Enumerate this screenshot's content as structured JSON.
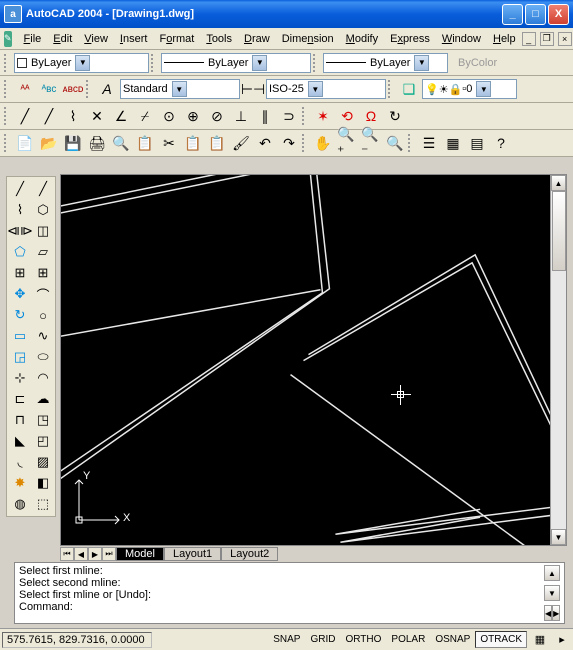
{
  "title": "AutoCAD 2004 - [Drawing1.dwg]",
  "menu": [
    "File",
    "Edit",
    "View",
    "Insert",
    "Format",
    "Tools",
    "Draw",
    "Dimension",
    "Modify",
    "Express",
    "Window",
    "Help"
  ],
  "layer_combo": "ByLayer",
  "linetype_combo": "ByLayer",
  "lineweight_combo": "ByLayer",
  "bycolor": "ByColor",
  "style_combo": "Standard",
  "dimstyle_combo": "ISO-25",
  "layer_state_num": "0",
  "tabs": {
    "model": "Model",
    "l1": "Layout1",
    "l2": "Layout2"
  },
  "cmd": {
    "l1": "Select first mline:",
    "l2": "Select second mline:",
    "l3": "Select first mline or [Undo]:",
    "l4": "Command:"
  },
  "coords": "575.7615, 829.7316, 0.0000",
  "status_toggles": [
    "SNAP",
    "GRID",
    "ORTHO",
    "POLAR",
    "OSNAP",
    "OTRACK"
  ],
  "ucs": {
    "x": "X",
    "y": "Y"
  }
}
